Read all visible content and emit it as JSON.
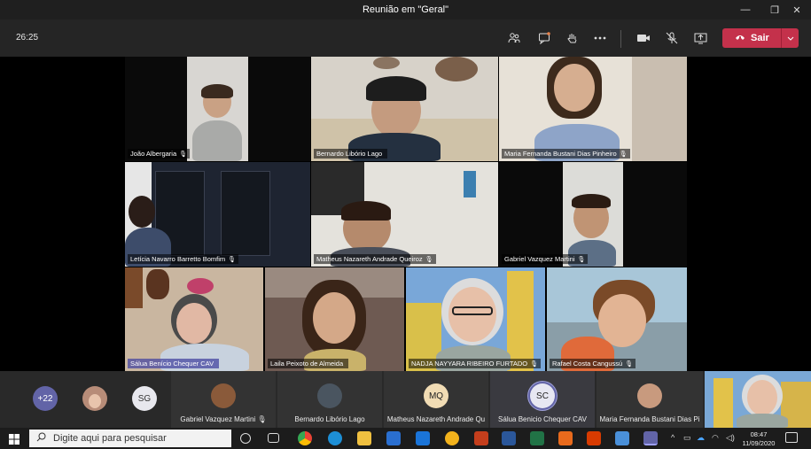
{
  "window": {
    "title": "Reunião em \"Geral\"",
    "minimize": "—",
    "restore": "❐",
    "close": "✕"
  },
  "toolbar": {
    "timer": "26:25",
    "leave_label": "Sair"
  },
  "icons": {
    "participants": "participants-icon",
    "chat": "chat-icon",
    "raise_hand": "raise-hand-icon",
    "more": "more-icon",
    "camera": "camera-icon",
    "mic": "mic-off-icon",
    "share": "share-screen-icon",
    "phone": "phone-hangup-icon",
    "chevron": "chevron-down-icon"
  },
  "tiles": [
    {
      "name": "João Albergaria",
      "muted": "🎙"
    },
    {
      "name": "Bernardo Libório Lago",
      "muted": ""
    },
    {
      "name": "Maria Fernanda Bustani Dias Pinheiro",
      "muted": "🎙"
    },
    {
      "name": "Letícia Navarro Barretto Bomfim",
      "muted": "🎙"
    },
    {
      "name": "Matheus Nazareth Andrade Queiroz",
      "muted": "🎙"
    },
    {
      "name": "Gabriel Vazquez Martini",
      "muted": "🎙"
    },
    {
      "name": "Sálua Benício Chequer CAV",
      "muted": ""
    },
    {
      "name": "Laila Peixoto de Almeida",
      "muted": ""
    },
    {
      "name": "NADJA NAYYARA RIBEIRO FURTADO",
      "muted": "🎙"
    },
    {
      "name": "Rafael Costa Cangussú",
      "muted": "🎙"
    }
  ],
  "strip": {
    "overflow": "+22",
    "sg": "SG",
    "cards": [
      {
        "name": "Gabriel Vazquez Martini",
        "initials": "",
        "muted": "🎙"
      },
      {
        "name": "Bernardo Libório Lago",
        "initials": ""
      },
      {
        "name": "Matheus Nazareth Andrade Qu",
        "initials": "MQ"
      },
      {
        "name": "Sálua Benicio Chequer CAV",
        "initials": "SC"
      },
      {
        "name": "Maria Fernanda Bustani Dias Pi",
        "initials": ""
      }
    ]
  },
  "taskbar": {
    "search_placeholder": "Digite aqui para pesquisar",
    "time": "08:47",
    "date": "11/09/2020"
  },
  "colors": {
    "leave": "#c4314b",
    "accent": "#6264a7",
    "titlebar": "#1f1f1f",
    "toolbar": "#252525"
  }
}
